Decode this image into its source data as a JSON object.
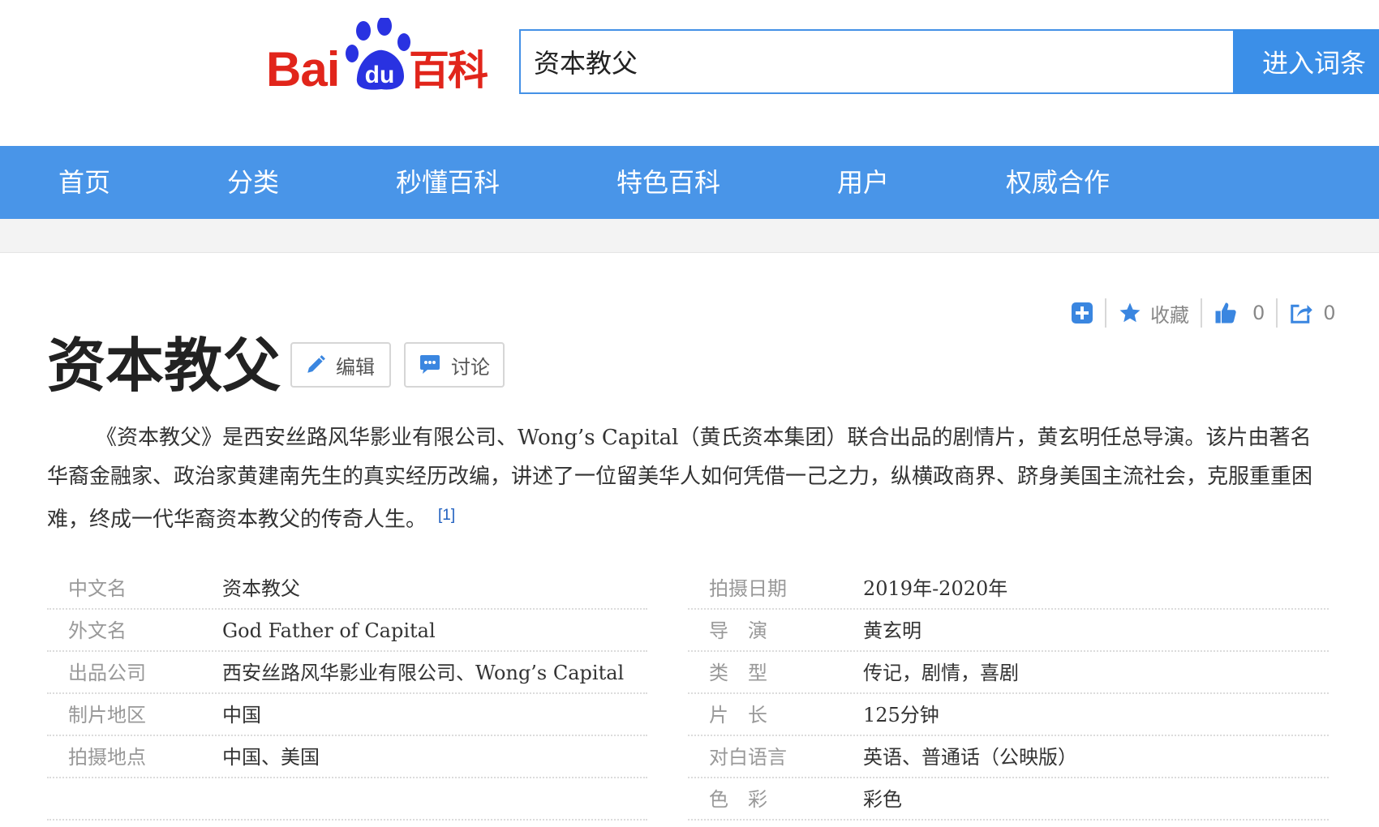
{
  "header": {
    "logo_text_bai": "Bai",
    "logo_text_du": "du",
    "logo_text_baike": "百科",
    "search_value": "资本教父",
    "search_button": "进入词条"
  },
  "nav": {
    "items": [
      "首页",
      "分类",
      "秒懂百科",
      "特色百科",
      "用户",
      "权威合作"
    ]
  },
  "toolbar": {
    "collect_label": "收藏",
    "like_count": "0",
    "share_count": "0"
  },
  "entry": {
    "title": "资本教父",
    "edit_label": "编辑",
    "discuss_label": "讨论",
    "summary": "《资本教父》是西安丝路风华影业有限公司、Wong’s Capital（黄氏资本集团）联合出品的剧情片，黄玄明任总导演。该片由著名华裔金融家、政治家黄建南先生的真实经历改编，讲述了一位留美华人如何凭借一己之力，纵横政商界、跻身美国主流社会，克服重重困难，终成一代华裔资本教父的传奇人生。",
    "citation": "[1]"
  },
  "info_left": [
    {
      "key": "中文名",
      "value": "资本教父"
    },
    {
      "key": "外文名",
      "value": "God Father of Capital"
    },
    {
      "key": "出品公司",
      "value": "西安丝路风华影业有限公司、Wong’s Capital"
    },
    {
      "key": "制片地区",
      "value": "中国"
    },
    {
      "key": "拍摄地点",
      "value": "中国、美国"
    },
    {
      "key": "",
      "value": ""
    }
  ],
  "info_right": [
    {
      "key": "拍摄日期",
      "value": "2019年-2020年"
    },
    {
      "key": "导　演",
      "value": "黄玄明"
    },
    {
      "key": "类　型",
      "value": "传记，剧情，喜剧"
    },
    {
      "key": "片　长",
      "value": "125分钟"
    },
    {
      "key": "对白语言",
      "value": "英语、普通话（公映版）"
    },
    {
      "key": "色　彩",
      "value": "彩色"
    }
  ],
  "colors": {
    "brand_red": "#e1251b",
    "brand_blue": "#2932e1",
    "nav_blue": "#4995e8",
    "search_blue": "#3b8fe8",
    "link_blue": "#1f5fbf"
  }
}
